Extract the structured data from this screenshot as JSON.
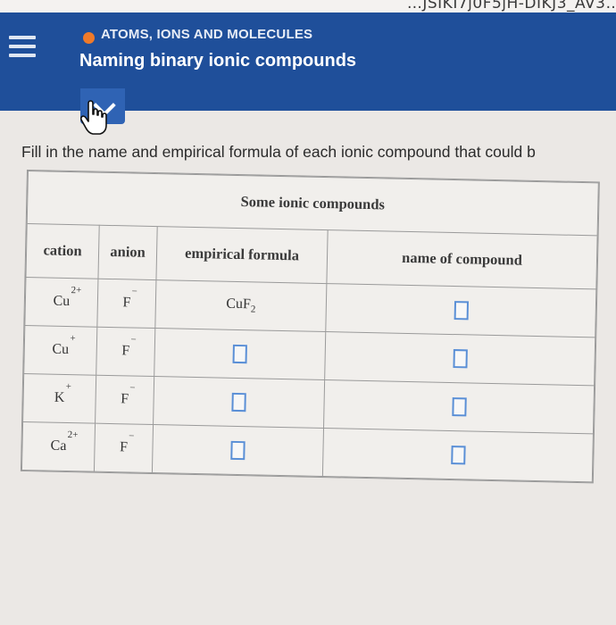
{
  "browser": {
    "url_fragment": "…JSIKI7j0F5jH-DIKJ3_AV3…"
  },
  "header": {
    "subject": "ATOMS, IONS AND MOLECULES",
    "title": "Naming binary ionic compounds",
    "subject_dot_color": "#ef7a2a",
    "background_color": "#1f4f9a"
  },
  "instruction": "Fill in the name and empirical formula of each ionic compound that could b",
  "table": {
    "caption": "Some ionic compounds",
    "headers": {
      "cation": "cation",
      "anion": "anion",
      "empirical_formula": "empirical formula",
      "name": "name of compound"
    },
    "rows": [
      {
        "cation": "Cu",
        "cation_charge": "2+",
        "anion": "F",
        "anion_charge": "−",
        "formula": "CuF",
        "formula_subscript": "2",
        "formula_filled": true
      },
      {
        "cation": "Cu",
        "cation_charge": "+",
        "anion": "F",
        "anion_charge": "−",
        "formula": "",
        "formula_subscript": "",
        "formula_filled": false
      },
      {
        "cation": "K",
        "cation_charge": "+",
        "anion": "F",
        "anion_charge": "−",
        "formula": "",
        "formula_subscript": "",
        "formula_filled": false
      },
      {
        "cation": "Ca",
        "cation_charge": "2+",
        "anion": "F",
        "anion_charge": "−",
        "formula": "",
        "formula_subscript": "",
        "formula_filled": false
      }
    ]
  },
  "icons": {
    "menu": "hamburger-icon",
    "collapse": "chevron-down-icon",
    "cursor": "hand-pointer-icon",
    "answer": "empty-answer-box"
  }
}
